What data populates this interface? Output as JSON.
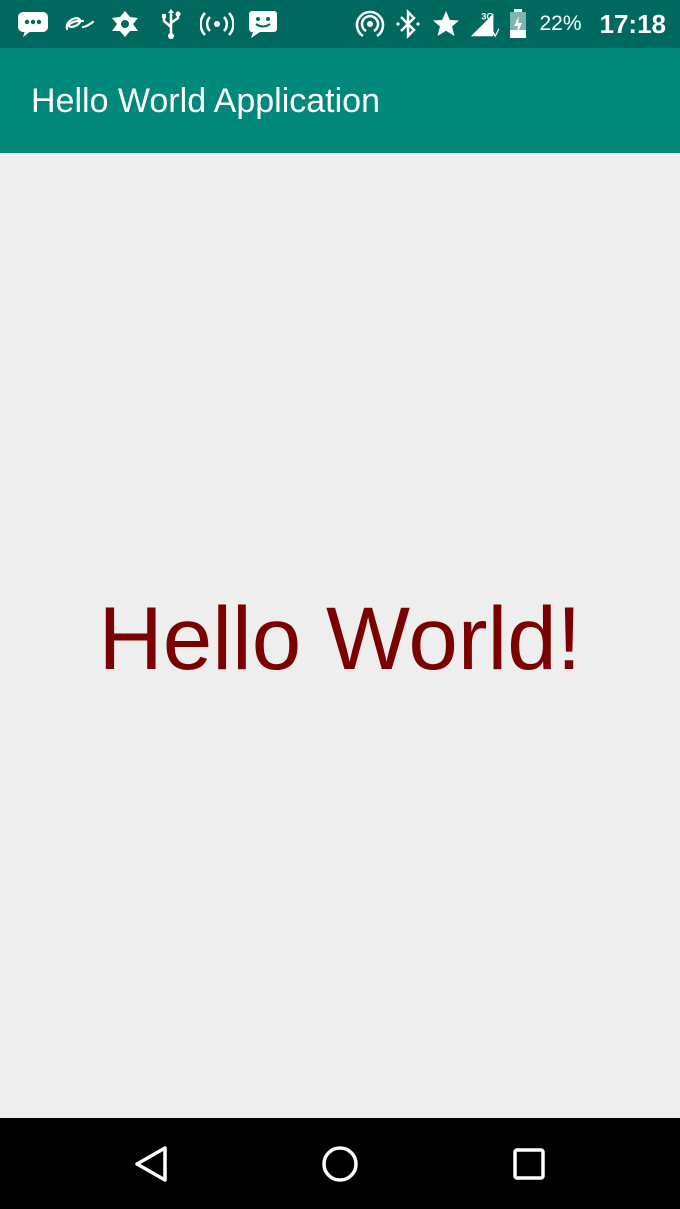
{
  "status_bar": {
    "battery_percent": "22%",
    "time": "17:18",
    "network_type": "3G",
    "left_icons": [
      "message-icon",
      "alibaba-icon",
      "vpn-icon",
      "usb-icon",
      "hotspot-icon",
      "chat-icon"
    ],
    "right_icons": [
      "cast-icon",
      "bluetooth-icon",
      "star-icon",
      "signal-icon",
      "battery-icon"
    ]
  },
  "app_bar": {
    "title": "Hello World Application",
    "color": "#00897b"
  },
  "main": {
    "greeting": "Hello World!",
    "greeting_color": "#7b0000"
  },
  "nav_bar": {
    "buttons": [
      "back-icon",
      "home-icon",
      "recents-icon"
    ]
  }
}
